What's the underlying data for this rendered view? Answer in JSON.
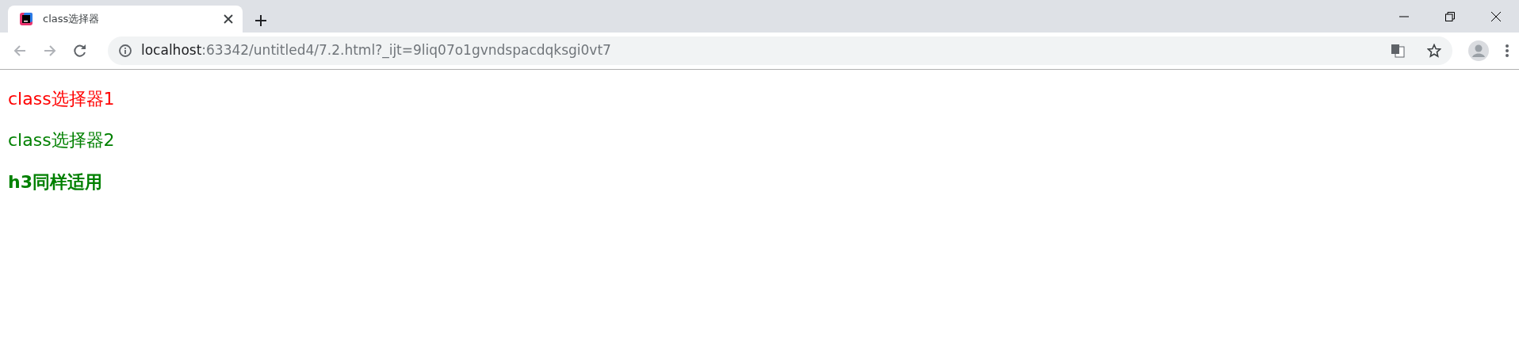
{
  "tabs": [
    {
      "title": "class选择器",
      "selected": true
    }
  ],
  "address_bar": {
    "host": "localhost",
    "path": ":63342/untitled4/7.2.html?_ijt=9liq07o1gvndspacdqksgi0vt7"
  },
  "content": [
    {
      "kind": "paragraph",
      "text": "class选择器1",
      "color": "#ff0000"
    },
    {
      "kind": "paragraph",
      "text": "class选择器2",
      "color": "#008000"
    },
    {
      "kind": "heading",
      "text": "h3同样适用",
      "color": "#008000"
    }
  ]
}
